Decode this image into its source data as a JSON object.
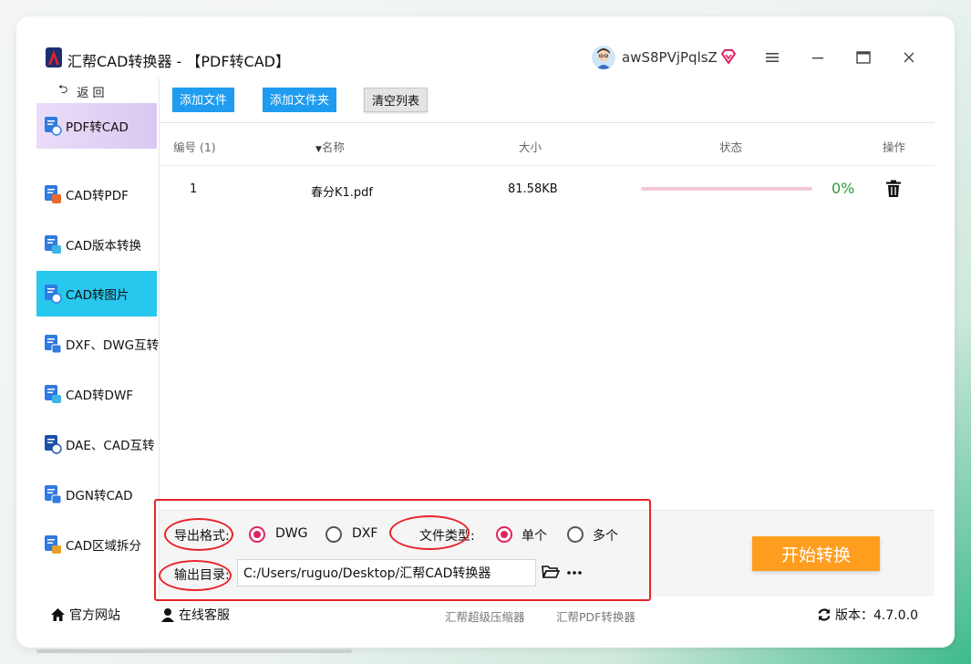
{
  "window": {
    "title": "汇帮CAD转换器 - 【PDF转CAD】",
    "username": "awS8PVjPqlsZ"
  },
  "sidebar": {
    "back_label": "返 回",
    "items": [
      {
        "label": "PDF转CAD"
      },
      {
        "label": "CAD转PDF"
      },
      {
        "label": "CAD版本转换"
      },
      {
        "label": "CAD转图片"
      },
      {
        "label": "DXF、DWG互转"
      },
      {
        "label": "CAD转DWF"
      },
      {
        "label": "DAE、CAD互转"
      },
      {
        "label": "DGN转CAD"
      },
      {
        "label": "CAD区域拆分"
      }
    ]
  },
  "toolbar": {
    "add_file": "添加文件",
    "add_folder": "添加文件夹",
    "clear_list": "清空列表"
  },
  "table": {
    "headers": {
      "index": "编号 (1)",
      "name": "名称",
      "size": "大小",
      "status": "状态",
      "action": "操作"
    },
    "rows": [
      {
        "index": "1",
        "name": "春分K1.pdf",
        "size": "81.58KB",
        "progress": 0,
        "progress_text": "0%"
      }
    ]
  },
  "options": {
    "format_label": "导出格式:",
    "format_dwg": "DWG",
    "format_dxf": "DXF",
    "filetype_label": "文件类型:",
    "single": "单个",
    "multiple": "多个",
    "output_label": "输出目录:",
    "output_path": "C:/Users/ruguo/Desktop/汇帮CAD转换器",
    "start_button": "开始转换"
  },
  "footer": {
    "website": "官方网站",
    "support": "在线客服",
    "compressor": "汇帮超级压缩器",
    "pdf_converter": "汇帮PDF转换器",
    "version": "版本：4.7.0.0"
  },
  "colors": {
    "accent_blue": "#1f9cf0",
    "selected_nav": "#28c7ee",
    "start_orange": "#ff9d1e",
    "radio_active": "#e0245e",
    "annotation_red": "#e8232a",
    "progress_green": "#2c9a3a"
  }
}
